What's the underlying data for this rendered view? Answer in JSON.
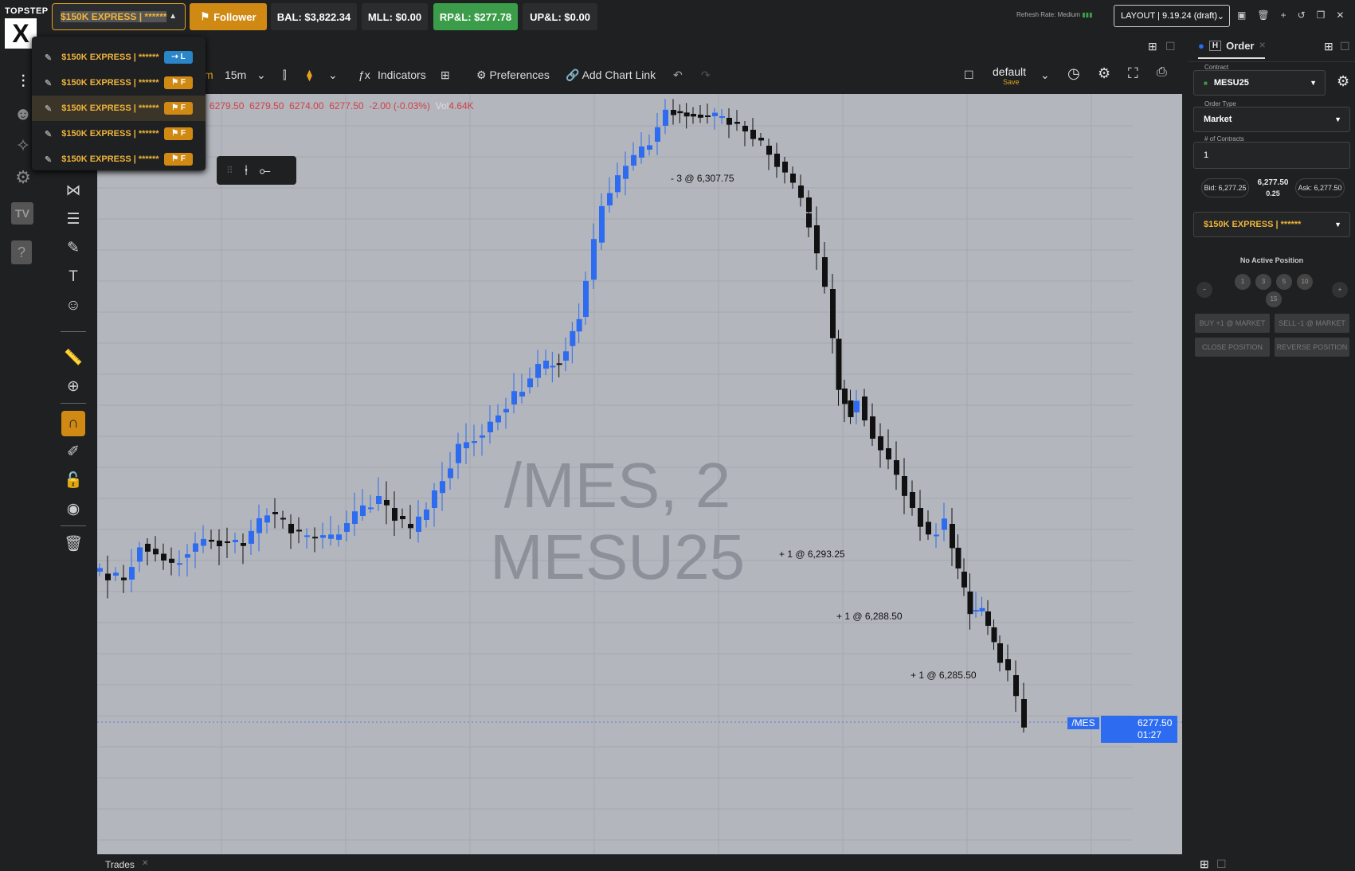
{
  "logo": {
    "line1": "TOPSTEP",
    "line2": "X"
  },
  "account": {
    "selected": "$150K EXPRESS | ******"
  },
  "stats": {
    "follower": "Follower",
    "bal": "BAL: $3,822.34",
    "mll": "MLL: $0.00",
    "rpl": "RP&L: $277.78",
    "upl": "UP&L: $0.00"
  },
  "refresh": "Refresh Rate: Medium",
  "layout": "LAYOUT | 9.19.24 (draft)",
  "dropdown": [
    {
      "label": "$150K EXPRESS | ******",
      "tag": "L"
    },
    {
      "label": "$150K EXPRESS | ******",
      "tag": "F"
    },
    {
      "label": "$150K EXPRESS | ******",
      "tag": "F"
    },
    {
      "label": "$150K EXPRESS | ******",
      "tag": "F"
    },
    {
      "label": "$150K EXPRESS | ******",
      "tag": "F"
    }
  ],
  "chart_toolbar": {
    "m": "m",
    "interval": "15m",
    "indicators": "Indicators",
    "preferences": "Preferences",
    "chartlink": "Add Chart Link",
    "template": "default",
    "save": "Save"
  },
  "ohlc": {
    "o": "6279.50",
    "h": "6279.50",
    "l": "6274.00",
    "c": "6277.50",
    "chg": "-2.00 (-0.03%)",
    "vol_label": "Vol",
    "vol": "4.64K"
  },
  "watermark": {
    "line1": "/MES, 2",
    "line2": "MESU25"
  },
  "trades_annot": [
    {
      "text": "- 3 @ 6,307.75"
    },
    {
      "text": "+ 1 @ 6,293.25"
    },
    {
      "text": "+ 1 @ 6,288.50"
    },
    {
      "text": "+ 1 @ 6,285.50"
    }
  ],
  "price_tag": {
    "symbol": "/MES",
    "price": "6277.50",
    "timer": "01:27"
  },
  "chart_data": {
    "type": "candlestick",
    "y_range": [
      6270,
      6310
    ]
  },
  "order_panel": {
    "title": "Order",
    "contract_label": "Contract",
    "contract": "MESU25",
    "order_type_label": "Order Type",
    "order_type": "Market",
    "contracts_label": "# of Contracts",
    "contracts": "1",
    "bid": "Bid: 6,277.25",
    "last": "6,277.50",
    "spread": "0.25",
    "ask": "Ask: 6,277.50",
    "account": "$150K EXPRESS | ******",
    "position": "No Active Position",
    "qty": [
      "1",
      "3",
      "5",
      "10",
      "15"
    ],
    "buy": "BUY +1 @ MARKET",
    "sell": "SELL -1 @ MARKET",
    "close": "CLOSE POSITION",
    "reverse": "REVERSE POSITION"
  },
  "bottom": {
    "tab": "Trades"
  }
}
